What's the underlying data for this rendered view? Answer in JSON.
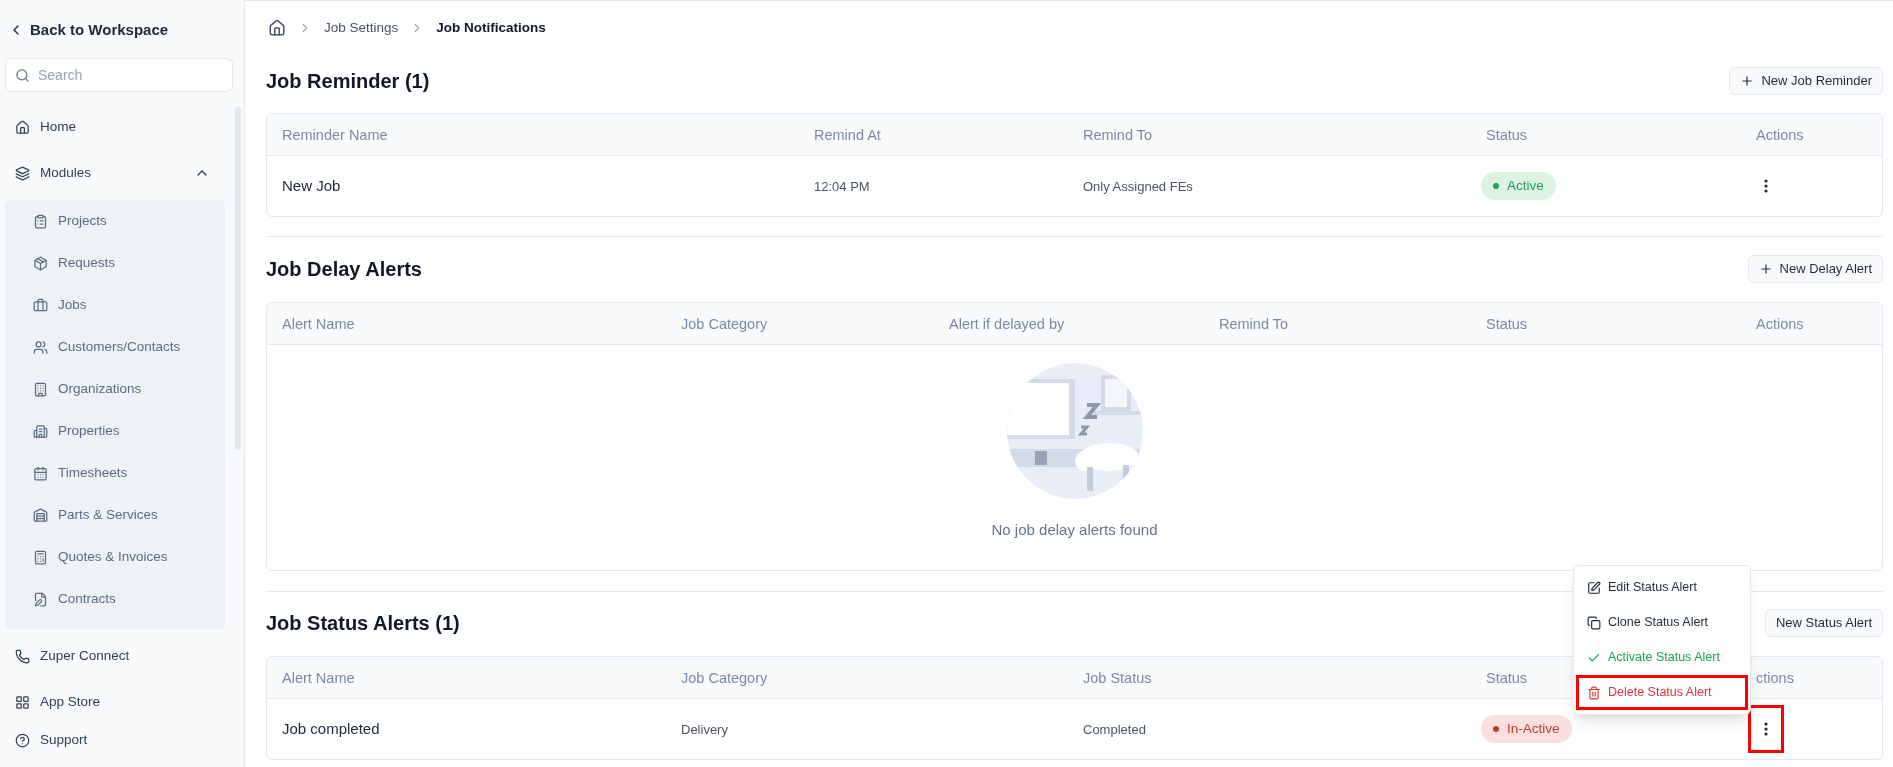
{
  "sidebar": {
    "back_link": "Back to Workspace",
    "search": {
      "placeholder": "Search"
    },
    "top_items": [
      "Home"
    ],
    "modules": {
      "label": "Modules",
      "expanded": true,
      "children": [
        "Projects",
        "Requests",
        "Jobs",
        "Customers/Contacts",
        "Organizations",
        "Properties",
        "Timesheets",
        "Parts & Services",
        "Quotes & Invoices",
        "Contracts"
      ]
    },
    "bottom_items": [
      "Zuper Connect",
      "App Store",
      "Support"
    ]
  },
  "breadcrumb": [
    {
      "label": "Job Settings",
      "current": false
    },
    {
      "label": "Job Notifications",
      "current": true
    }
  ],
  "sections": [
    {
      "title": "Job Reminder (1)",
      "button": {
        "label": "New Job Reminder",
        "icon_visible": true
      },
      "columns": [
        "Reminder Name",
        "Remind At",
        "Remind To",
        "Status",
        "Actions"
      ],
      "rows": [
        {
          "cells": [
            "New Job",
            "12:04 PM",
            "Only Assigned FEs"
          ],
          "status": {
            "label": "Active",
            "kind": "active"
          },
          "actions_highlighted": false
        }
      ]
    },
    {
      "title": "Job Delay Alerts",
      "button": {
        "label": "New Delay Alert",
        "icon_visible": true
      },
      "columns": [
        "Alert Name",
        "Job Category",
        "Alert if delayed by",
        "Remind To",
        "Status",
        "Actions"
      ],
      "empty": {
        "kind": "picture",
        "message": "No job delay alerts found"
      }
    },
    {
      "title": "Job Status Alerts (1)",
      "button": {
        "label": "New Status Alert",
        "icon_visible": false
      },
      "columns": [
        "Alert Name",
        "Job Category",
        "Job Status",
        "Status",
        "ctions"
      ],
      "rows": [
        {
          "cells": [
            "Job completed",
            "Delivery",
            "Completed"
          ],
          "status": {
            "label": "In-Active",
            "kind": "inactive"
          },
          "actions_highlighted": true,
          "menu": {
            "items": [
              {
                "label": "Edit Status Alert",
                "kind": "edit",
                "highlighted": false
              },
              {
                "label": "Clone Status Alert",
                "kind": "clone",
                "highlighted": false
              },
              {
                "label": "Activate Status Alert",
                "kind": "activate",
                "highlighted": false
              },
              {
                "label": "Delete Status Alert",
                "kind": "delete",
                "highlighted": true
              }
            ]
          }
        }
      ]
    }
  ]
}
